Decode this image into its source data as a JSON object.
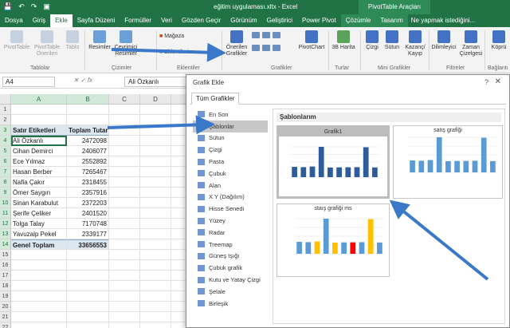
{
  "window": {
    "title": "eğitim uygulaması.xltx - Excel",
    "context_tab_group": "PivotTable Araçları"
  },
  "ribbon_tabs": [
    {
      "label": "Dosya"
    },
    {
      "label": "Giriş"
    },
    {
      "label": "Ekle",
      "active": true
    },
    {
      "label": "Sayfa Düzeni"
    },
    {
      "label": "Formüller"
    },
    {
      "label": "Veri"
    },
    {
      "label": "Gözden Geçir"
    },
    {
      "label": "Görünüm"
    },
    {
      "label": "Geliştirici"
    },
    {
      "label": "Power Pivot"
    },
    {
      "label": "Çözümle",
      "context": true
    },
    {
      "label": "Tasarım",
      "context": true
    }
  ],
  "tell_me": "Ne yapmak istediğini...",
  "ribbon": {
    "pivottable": "PivotTable",
    "pivottable_recommended": "PivotTable Önerileri",
    "table": "Tablo",
    "group_tables": "Tablolar",
    "images": "Resimler",
    "online_images": "Çevrimiçi Resimler",
    "group_illustrations": "Çizimler",
    "store": "Mağaza",
    "addins": "Eklentilerim",
    "group_addins": "Eklentiler",
    "recommended_charts": "Önerilen Grafikler",
    "pivotchart": "PivotChart",
    "group_charts": "Grafikler",
    "map3d": "3B Harita",
    "group_tours": "Turlar",
    "sparkline_line": "Çizgi",
    "sparkline_column": "Sütun",
    "sparkline_winloss": "Kazanç/ Kayıp",
    "group_sparklines": "Mini Grafikler",
    "slicer": "Dilimleyici",
    "timeline": "Zaman Çizelgesi",
    "group_filters": "Filtreler",
    "group_links": "Bağlantı",
    "link": "Köprü"
  },
  "formula_bar": {
    "name_box": "A4",
    "value": "Ali Özkanlı"
  },
  "sheet": {
    "columns": [
      "A",
      "B",
      "C",
      "D"
    ],
    "rows": [
      "1",
      "2",
      "3",
      "4",
      "5",
      "6",
      "7",
      "8",
      "9",
      "10",
      "11",
      "12",
      "13",
      "14",
      "15",
      "16",
      "17",
      "18",
      "19",
      "20",
      "21",
      "22",
      "23"
    ],
    "header": {
      "label": "Satır Etiketleri",
      "total": "Toplam Tutar"
    },
    "data": [
      {
        "name": "Ali Özkanlı",
        "value": "2472098"
      },
      {
        "name": "Cihan Demirci",
        "value": "2406077"
      },
      {
        "name": "Ece Yılmaz",
        "value": "2552892"
      },
      {
        "name": "Hasan Berber",
        "value": "7265467"
      },
      {
        "name": "Nafia Çakır",
        "value": "2318455"
      },
      {
        "name": "Ömer Saygın",
        "value": "2357916"
      },
      {
        "name": "Sinan Karabulut",
        "value": "2372203"
      },
      {
        "name": "Şerife Çeliker",
        "value": "2401520"
      },
      {
        "name": "Tolga Talay",
        "value": "7170748"
      },
      {
        "name": "Yavuzalp Pekel",
        "value": "2339177"
      }
    ],
    "grand_total": {
      "label": "Genel Toplam",
      "value": "33656553"
    }
  },
  "dialog": {
    "title": "Grafik Ekle",
    "help": "?",
    "close": "✕",
    "tab": "Tüm Grafikler",
    "section_title": "Şablonlarım",
    "chart_types": [
      {
        "label": "En Son",
        "icon": "recent-icon"
      },
      {
        "label": "Şablonlar",
        "icon": "folder-icon",
        "selected": true
      },
      {
        "label": "Sütun",
        "icon": "column-chart-icon"
      },
      {
        "label": "Çizgi",
        "icon": "line-chart-icon"
      },
      {
        "label": "Pasta",
        "icon": "pie-chart-icon"
      },
      {
        "label": "Çubuk",
        "icon": "bar-chart-icon"
      },
      {
        "label": "Alan",
        "icon": "area-chart-icon"
      },
      {
        "label": "X Y (Dağılım)",
        "icon": "scatter-chart-icon"
      },
      {
        "label": "Hisse Senedi",
        "icon": "stock-chart-icon"
      },
      {
        "label": "Yüzey",
        "icon": "surface-chart-icon"
      },
      {
        "label": "Radar",
        "icon": "radar-chart-icon"
      },
      {
        "label": "Treemap",
        "icon": "treemap-icon"
      },
      {
        "label": "Güneş Işığı",
        "icon": "sunburst-icon"
      },
      {
        "label": "Çubuk grafik",
        "icon": "histogram-icon"
      },
      {
        "label": "Kutu ve Yatay Çizgi",
        "icon": "box-whisker-icon"
      },
      {
        "label": "Şelale",
        "icon": "waterfall-icon"
      },
      {
        "label": "Birleşik",
        "icon": "combo-chart-icon"
      }
    ],
    "templates": [
      {
        "title": "Grafik1",
        "selected": true,
        "bar_color": "#2e5c9a"
      },
      {
        "title": "satış grafiği",
        "bar_color": "#5b9bd5"
      },
      {
        "title": "staış grafiği ms",
        "bar_color": "#5b9bd5",
        "highlight_color": "#ff0000",
        "accent_color": "#ffc000"
      }
    ]
  },
  "colors": {
    "excel_green": "#217346",
    "arrow_blue": "#3a78c9",
    "pivot_header": "#dde7f0"
  }
}
